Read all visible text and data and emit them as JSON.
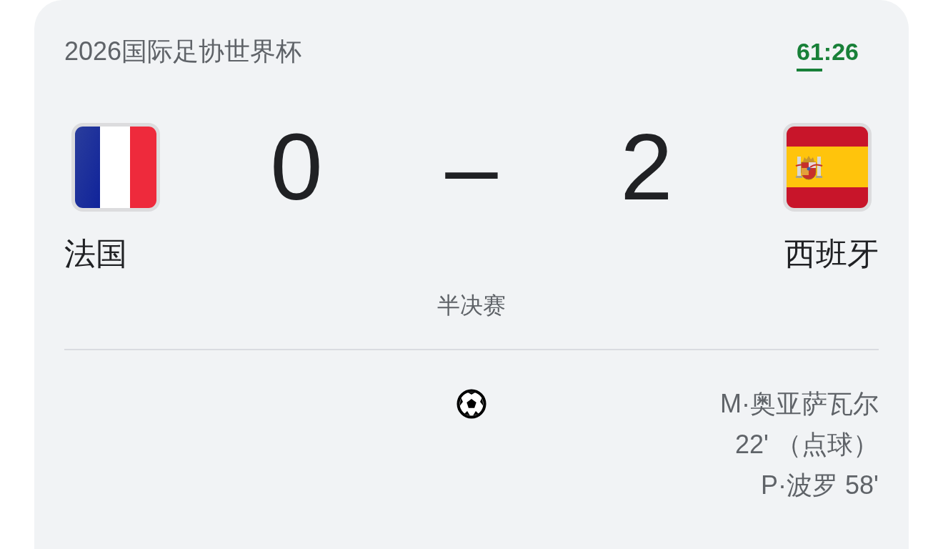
{
  "competition": "2026国际足协世界杯",
  "clock": "61:26",
  "home": {
    "name": "法国",
    "score": "0"
  },
  "away": {
    "name": "西班牙",
    "score": "2",
    "goals": [
      "M·奥亚萨瓦尔 22' （点球）",
      "P·波罗 58'"
    ]
  },
  "separator": "–",
  "stage": "半决赛"
}
